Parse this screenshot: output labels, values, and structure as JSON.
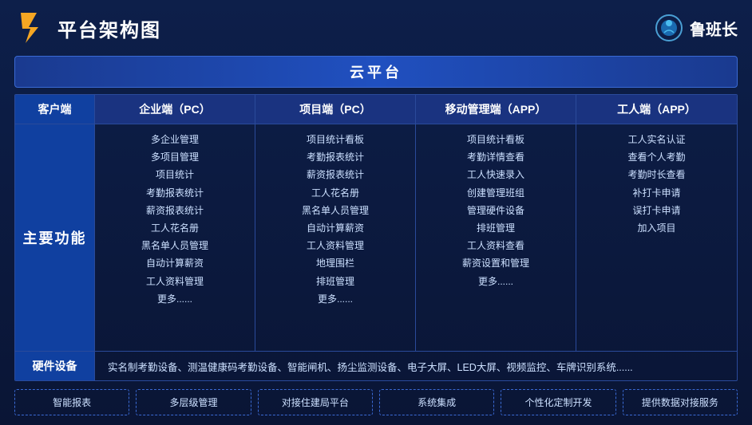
{
  "header": {
    "title": "平台架构图",
    "brand_name": "鲁班长"
  },
  "cloud_platform": {
    "label": "云平台"
  },
  "col_headers": {
    "client": "客户端",
    "enterprise": "企业端（PC）",
    "project": "项目端（PC）",
    "mobile": "移动管理端（APP）",
    "worker": "工人端（APP）"
  },
  "row_label": "主要功能",
  "enterprise_features": [
    "多企业管理",
    "多项目管理",
    "项目统计",
    "考勤报表统计",
    "薪资报表统计",
    "工人花名册",
    "黑名单人员管理",
    "自动计算薪资",
    "工人资料管理",
    "更多......"
  ],
  "project_features": [
    "项目统计看板",
    "考勤报表统计",
    "薪资报表统计",
    "工人花名册",
    "黑名单人员管理",
    "自动计算薪资",
    "工人资料管理",
    "地理围栏",
    "排班管理",
    "更多......"
  ],
  "mobile_features": [
    "项目统计看板",
    "考勤详情查看",
    "工人快速录入",
    "创建管理班组",
    "管理硬件设备",
    "排班管理",
    "工人资料查看",
    "薪资设置和管理",
    "更多......"
  ],
  "worker_features": [
    "工人实名认证",
    "查看个人考勤",
    "考勤时长查看",
    "补打卡申请",
    "误打卡申请",
    "加入项目"
  ],
  "hardware": {
    "label": "硬件设备",
    "content": "实名制考勤设备、测温健康码考勤设备、智能闸机、扬尘监测设备、电子大屏、LED大屏、视频监控、车牌识别系统......"
  },
  "bottom_items": [
    "智能报表",
    "多层级管理",
    "对接住建局平台",
    "系统集成",
    "个性化定制开发",
    "提供数据对接服务"
  ]
}
